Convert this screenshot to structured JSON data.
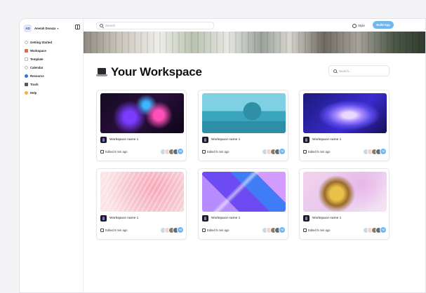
{
  "sidebar": {
    "workspace_initials": "AD",
    "workspace_name": "Anerah Dsouza",
    "items": [
      {
        "label": "Getting Started",
        "icon": "sparkle-icon",
        "color": "#c9c9d2"
      },
      {
        "label": "Workspace",
        "icon": "workspace-icon",
        "color": "#e0674f"
      },
      {
        "label": "Template",
        "icon": "template-icon",
        "color": "#b8b8c0"
      },
      {
        "label": "Calendar",
        "icon": "calendar-icon",
        "color": "#c9c9d2"
      },
      {
        "label": "Resource",
        "icon": "globe-icon",
        "color": "#3b6fd8"
      },
      {
        "label": "Trash",
        "icon": "trash-icon",
        "color": "#55555f"
      },
      {
        "label": "Help",
        "icon": "help-icon",
        "color": "#f1b33a"
      }
    ]
  },
  "topbar": {
    "search_placeholder": "Search",
    "style_label": "Style",
    "build_label": "Build App"
  },
  "main": {
    "title": "Your Workspace",
    "search_placeholder": "Search..."
  },
  "cards": [
    {
      "name": "Workspace name 1",
      "edited": "Edited 5 min ago",
      "more": "+2",
      "art": "dark-neon"
    },
    {
      "name": "Workspace name 1",
      "edited": "Edited 5 min ago",
      "more": "+2",
      "art": "teal-geo"
    },
    {
      "name": "Workspace name 1",
      "edited": "Edited 5 min ago",
      "more": "+2",
      "art": "blue-swirl"
    },
    {
      "name": "Workspace name 1",
      "edited": "Edited 5 min ago",
      "more": "+2",
      "art": "pink-feather"
    },
    {
      "name": "Workspace name 1",
      "edited": "Edited 5 min ago",
      "more": "+2",
      "art": "violet-glass"
    },
    {
      "name": "Workspace name 1",
      "edited": "Edited 5 min ago",
      "more": "+2",
      "art": "gold-liquid"
    }
  ],
  "colors": {
    "accent": "#6fb7f2"
  }
}
